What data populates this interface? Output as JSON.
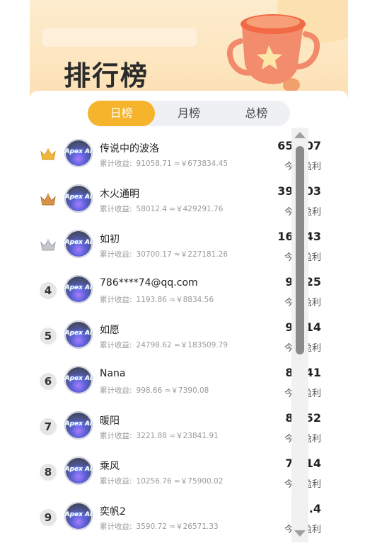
{
  "header": {
    "title": "排行榜"
  },
  "tabs": [
    {
      "label": "日榜",
      "active": true
    },
    {
      "label": "月榜",
      "active": false
    },
    {
      "label": "总榜",
      "active": false
    }
  ],
  "avatar_text": "Apex AI",
  "earn_label": "累计收益:",
  "profit_label": "今日盈利",
  "rows": [
    {
      "rank": "1",
      "medal": "gold-crown-icon",
      "name": "传说中的波洛",
      "earn": "91058.71 ≈￥673834.45",
      "profit": "659.07"
    },
    {
      "rank": "2",
      "medal": "bronze-crown-icon",
      "name": "木火通明",
      "earn": "58012.4 ≈￥429291.76",
      "profit": "396.03"
    },
    {
      "rank": "3",
      "medal": "silver-crown-icon",
      "name": "如初",
      "earn": "30700.17 ≈￥227181.26",
      "profit": "164.43"
    },
    {
      "rank": "4",
      "name": "786****74@qq.com",
      "earn": "1193.86 ≈￥8834.56",
      "profit": "97.25"
    },
    {
      "rank": "5",
      "name": "如愿",
      "earn": "24798.62 ≈￥183509.79",
      "profit": "96.14"
    },
    {
      "rank": "6",
      "name": "Nana",
      "earn": "998.66 ≈￥7390.08",
      "profit": "88.41"
    },
    {
      "rank": "7",
      "name": "暖阳",
      "earn": "3221.88 ≈￥23841.91",
      "profit": "83.52"
    },
    {
      "rank": "8",
      "name": "乘风",
      "earn": "10256.76 ≈￥75900.02",
      "profit": "70.14"
    },
    {
      "rank": "9",
      "name": "奕帆2",
      "earn": "3590.72 ≈￥26571.33",
      "profit": "62.4"
    }
  ],
  "colors": {
    "accent": "#f5b42b",
    "gold": "#f0b73a",
    "bronze": "#c9873e",
    "silver": "#b8bcc4"
  }
}
